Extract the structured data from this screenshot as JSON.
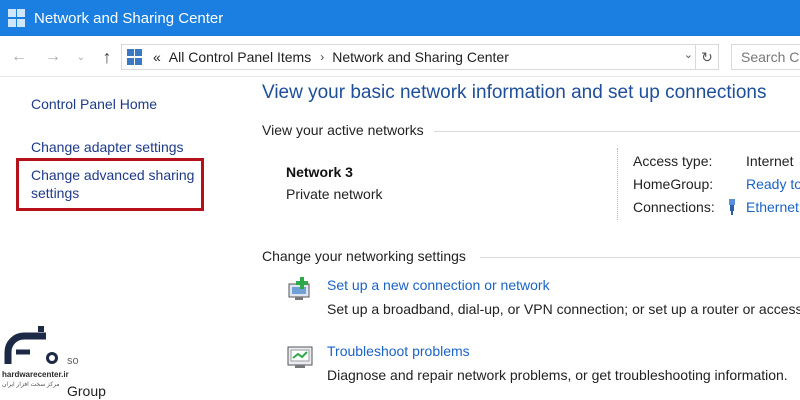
{
  "window": {
    "title": "Network and Sharing Center"
  },
  "nav": {
    "back_icon": "back-arrow-icon",
    "forward_icon": "forward-arrow-icon",
    "recent_icon": "chevron-down-icon",
    "up_icon": "up-arrow-icon",
    "address": {
      "overflow": "«",
      "crumbs": [
        "All Control Panel Items",
        "Network and Sharing Center"
      ],
      "separator": "›"
    },
    "refresh_icon": "refresh-icon",
    "search_placeholder": "Search Co"
  },
  "sidebar": {
    "items": [
      {
        "label": "Control Panel Home"
      },
      {
        "label": "Change adapter settings"
      },
      {
        "label": "Change advanced sharing settings",
        "line1": "Change advanced sharing",
        "line2": "settings"
      }
    ],
    "partial_labels": [
      "so",
      "Group"
    ]
  },
  "main": {
    "heading": "View your basic network information and set up connections",
    "active_networks": {
      "section_label": "View your active networks",
      "network_name": "Network  3",
      "network_type": "Private network",
      "props": [
        {
          "label": "Access type:",
          "value": "Internet",
          "link": false
        },
        {
          "label": "HomeGroup:",
          "value": "Ready to",
          "link": true
        },
        {
          "label": "Connections:",
          "value": "Ethernet",
          "link": true,
          "icon": "ethernet-icon"
        }
      ]
    },
    "settings": {
      "section_label": "Change your networking settings",
      "tasks": [
        {
          "icon": "new-connection-icon",
          "link": "Set up a new connection or network",
          "desc": "Set up a broadband, dial-up, or VPN connection; or set up a router or access"
        },
        {
          "icon": "troubleshoot-icon",
          "link": "Troubleshoot problems",
          "desc": "Diagnose and repair network problems, or get troubleshooting information."
        }
      ]
    }
  },
  "watermark": {
    "name": "hardwarecenter.ir",
    "tagline": "مرکز سخت افزار ایران"
  },
  "colors": {
    "titlebar": "#1a7fe0",
    "link": "#1a63c6",
    "heading": "#1e4e9a",
    "highlight": "#b4111b"
  }
}
